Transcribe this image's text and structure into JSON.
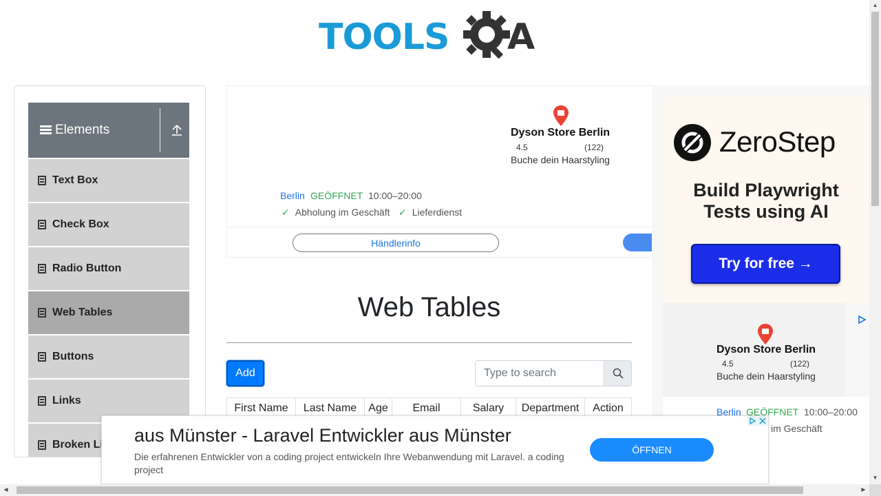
{
  "header": {
    "logo_text": "TOOLS",
    "logo_last": "A"
  },
  "sidebar": {
    "group_title": "Elements",
    "items": [
      {
        "label": "Text Box"
      },
      {
        "label": "Check Box"
      },
      {
        "label": "Radio Button"
      },
      {
        "label": "Web Tables"
      },
      {
        "label": "Buttons"
      },
      {
        "label": "Links"
      },
      {
        "label": "Broken Links"
      }
    ]
  },
  "ad_top": {
    "store_name": "Dyson Store Berlin",
    "rating": "4.5",
    "reviews": "(122)",
    "subtitle": "Buche dein Haarstyling",
    "city": "Berlin",
    "status": "GEÖFFNET",
    "hours": "10:00–20:00",
    "check1": "Abholung im Geschäft",
    "check2": "Lieferdienst",
    "dealer_button": "Händlerinfo"
  },
  "ad_right": {
    "brand": "ZeroStep",
    "tagline_line1": "Build Playwright",
    "tagline_line2": "Tests using AI",
    "cta": "Try for free →",
    "store_name": "Dyson Store Berlin",
    "rating": "4.5",
    "reviews": "(122)",
    "subtitle": "Buche dein Haarstyling",
    "city": "Berlin",
    "status": "GEÖFFNET",
    "hours": "10:00–20:00",
    "check1": "im Geschäft"
  },
  "main": {
    "title": "Web Tables",
    "add_label": "Add",
    "search_placeholder": "Type to search",
    "columns": [
      "First Name",
      "Last Name",
      "Age",
      "Email",
      "Salary",
      "Department",
      "Action"
    ]
  },
  "ad_bottom": {
    "headline": "aus Münster - Laravel Entwickler aus Münster",
    "body": "Die erfahrenen Entwickler von a coding project entwickeln Ihre Webanwendung mit Laravel. a coding project",
    "cta": "ÖFFNEN"
  },
  "colors": {
    "brand_blue": "#1a9bd7",
    "primary": "#007bff",
    "sidebar_header": "#6c757d",
    "open_green": "#34a853"
  }
}
